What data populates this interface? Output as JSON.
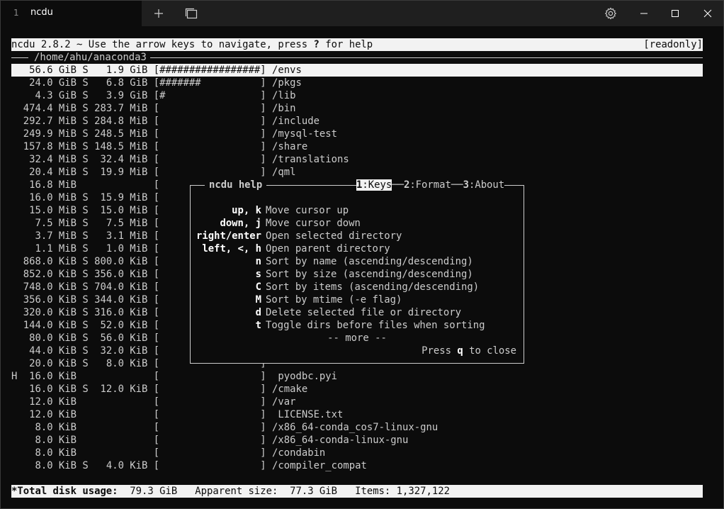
{
  "window": {
    "tab_number": "1",
    "tab_title": "ncdu",
    "new_tab_icon": "plus-icon",
    "tabs_menu_icon": "tab-switcher-icon",
    "settings_icon": "gear-icon",
    "minimize_icon": "minimize-icon",
    "maximize_icon": "maximize-icon",
    "close_icon": "close-icon"
  },
  "header": {
    "left": "ncdu 2.8.2 ~ Use the arrow keys to navigate, press ",
    "help_key": "?",
    "left_tail": " for help",
    "right": "[readonly]"
  },
  "path": "/home/ahu/anaconda3",
  "rows": [
    {
      "flag": " ",
      "disk": "56.6 GiB",
      "s": "S",
      "apparent": "1.9 GiB",
      "bar": "#################",
      "name": "/envs",
      "selected": true
    },
    {
      "flag": " ",
      "disk": "24.0 GiB",
      "s": "S",
      "apparent": "6.8 GiB",
      "bar": "#######          ",
      "name": "/pkgs",
      "selected": false
    },
    {
      "flag": " ",
      "disk": "4.3 GiB",
      "s": "S",
      "apparent": "3.9 GiB",
      "bar": "#                ",
      "name": "/lib",
      "selected": false
    },
    {
      "flag": " ",
      "disk": "474.4 MiB",
      "s": "S",
      "apparent": "283.7 MiB",
      "bar": "                 ",
      "name": "/bin",
      "selected": false
    },
    {
      "flag": " ",
      "disk": "292.7 MiB",
      "s": "S",
      "apparent": "284.8 MiB",
      "bar": "                 ",
      "name": "/include",
      "selected": false
    },
    {
      "flag": " ",
      "disk": "249.9 MiB",
      "s": "S",
      "apparent": "248.5 MiB",
      "bar": "                 ",
      "name": "/mysql-test",
      "selected": false
    },
    {
      "flag": " ",
      "disk": "157.8 MiB",
      "s": "S",
      "apparent": "148.5 MiB",
      "bar": "                 ",
      "name": "/share",
      "selected": false
    },
    {
      "flag": " ",
      "disk": "32.4 MiB",
      "s": "S",
      "apparent": "32.4 MiB",
      "bar": "                 ",
      "name": "/translations",
      "selected": false
    },
    {
      "flag": " ",
      "disk": "20.4 MiB",
      "s": "S",
      "apparent": "19.9 MiB",
      "bar": "                 ",
      "name": "/qml",
      "selected": false
    },
    {
      "flag": " ",
      "disk": "16.8 MiB",
      "s": " ",
      "apparent": "",
      "bar": "",
      "name": "",
      "selected": false
    },
    {
      "flag": " ",
      "disk": "16.0 MiB",
      "s": "S",
      "apparent": "15.9 MiB",
      "bar": "",
      "name": "",
      "selected": false
    },
    {
      "flag": " ",
      "disk": "15.0 MiB",
      "s": "S",
      "apparent": "15.0 MiB",
      "bar": "",
      "name": "",
      "selected": false
    },
    {
      "flag": " ",
      "disk": "7.5 MiB",
      "s": "S",
      "apparent": "7.5 MiB",
      "bar": "",
      "name": "",
      "selected": false
    },
    {
      "flag": " ",
      "disk": "3.7 MiB",
      "s": "S",
      "apparent": "3.1 MiB",
      "bar": "",
      "name": "",
      "selected": false
    },
    {
      "flag": " ",
      "disk": "1.1 MiB",
      "s": "S",
      "apparent": "1.0 MiB",
      "bar": "",
      "name": "",
      "selected": false
    },
    {
      "flag": " ",
      "disk": "868.0 KiB",
      "s": "S",
      "apparent": "800.0 KiB",
      "bar": "",
      "name": "",
      "selected": false
    },
    {
      "flag": " ",
      "disk": "852.0 KiB",
      "s": "S",
      "apparent": "356.0 KiB",
      "bar": "",
      "name": "",
      "selected": false
    },
    {
      "flag": " ",
      "disk": "748.0 KiB",
      "s": "S",
      "apparent": "704.0 KiB",
      "bar": "",
      "name": "",
      "selected": false
    },
    {
      "flag": " ",
      "disk": "356.0 KiB",
      "s": "S",
      "apparent": "344.0 KiB",
      "bar": "",
      "name": "",
      "selected": false
    },
    {
      "flag": " ",
      "disk": "320.0 KiB",
      "s": "S",
      "apparent": "316.0 KiB",
      "bar": "",
      "name": "",
      "selected": false
    },
    {
      "flag": " ",
      "disk": "144.0 KiB",
      "s": "S",
      "apparent": "52.0 KiB",
      "bar": "",
      "name": "",
      "selected": false
    },
    {
      "flag": " ",
      "disk": "80.0 KiB",
      "s": "S",
      "apparent": "56.0 KiB",
      "bar": "",
      "name": "",
      "selected": false
    },
    {
      "flag": " ",
      "disk": "44.0 KiB",
      "s": "S",
      "apparent": "32.0 KiB",
      "bar": "",
      "name": "",
      "selected": false
    },
    {
      "flag": " ",
      "disk": "20.0 KiB",
      "s": "S",
      "apparent": "8.0 KiB",
      "bar": "",
      "name": "",
      "selected": false
    },
    {
      "flag": "H",
      "disk": "16.0 KiB",
      "s": " ",
      "apparent": "",
      "bar": "                 ",
      "name": " pyodbc.pyi",
      "selected": false
    },
    {
      "flag": " ",
      "disk": "16.0 KiB",
      "s": "S",
      "apparent": "12.0 KiB",
      "bar": "                 ",
      "name": "/cmake",
      "selected": false
    },
    {
      "flag": " ",
      "disk": "12.0 KiB",
      "s": " ",
      "apparent": "",
      "bar": "                 ",
      "name": "/var",
      "selected": false
    },
    {
      "flag": " ",
      "disk": "12.0 KiB",
      "s": " ",
      "apparent": "",
      "bar": "                 ",
      "name": " LICENSE.txt",
      "selected": false
    },
    {
      "flag": " ",
      "disk": "8.0 KiB",
      "s": " ",
      "apparent": "",
      "bar": "                 ",
      "name": "/x86_64-conda_cos7-linux-gnu",
      "selected": false
    },
    {
      "flag": " ",
      "disk": "8.0 KiB",
      "s": " ",
      "apparent": "",
      "bar": "                 ",
      "name": "/x86_64-conda-linux-gnu",
      "selected": false
    },
    {
      "flag": " ",
      "disk": "8.0 KiB",
      "s": " ",
      "apparent": "",
      "bar": "                 ",
      "name": "/condabin",
      "selected": false
    },
    {
      "flag": " ",
      "disk": "8.0 KiB",
      "s": "S",
      "apparent": "4.0 KiB",
      "bar": "                 ",
      "name": "/compiler_compat",
      "selected": false
    }
  ],
  "help": {
    "title": "ncdu help",
    "tabs": [
      {
        "num": "1",
        "label": ":Keys",
        "selected": true
      },
      {
        "num": "2",
        "label": ":Format",
        "selected": false
      },
      {
        "num": "3",
        "label": ":About",
        "selected": false
      }
    ],
    "keys": [
      {
        "key": "up, k",
        "desc": "Move cursor up"
      },
      {
        "key": "down, j",
        "desc": "Move cursor down"
      },
      {
        "key": "right/enter",
        "desc": "Open selected directory"
      },
      {
        "key": "left, <, h",
        "desc": "Open parent directory"
      },
      {
        "key": "n",
        "desc": "Sort by name (ascending/descending)"
      },
      {
        "key": "s",
        "desc": "Sort by size (ascending/descending)"
      },
      {
        "key": "C",
        "desc": "Sort by items (ascending/descending)"
      },
      {
        "key": "M",
        "desc": "Sort by mtime (-e flag)"
      },
      {
        "key": "d",
        "desc": "Delete selected file or directory"
      },
      {
        "key": "t",
        "desc": "Toggle dirs before files when sorting"
      }
    ],
    "more": "-- more --",
    "close_prefix": "Press ",
    "close_key": "q",
    "close_suffix": " to close"
  },
  "footer": {
    "total_label": "*Total disk usage:",
    "total_value": "79.3 GiB",
    "apparent_label": "Apparent size:",
    "apparent_value": "77.3 GiB",
    "items_label": "Items:",
    "items_value": "1,327,122"
  }
}
